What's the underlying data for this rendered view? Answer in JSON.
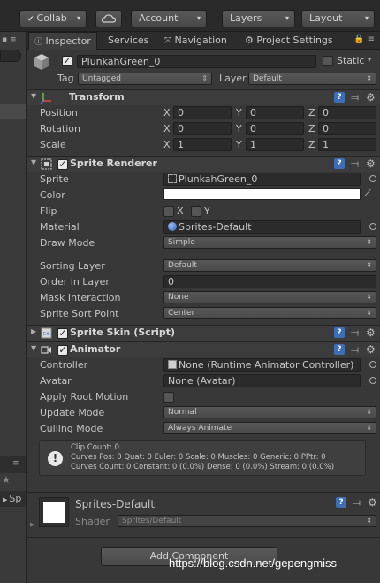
{
  "toolbar": {
    "collab_label": "Collab",
    "account_label": "Account",
    "layers_label": "Layers",
    "layout_label": "Layout",
    "cloud_icon": "cloud-icon",
    "close_glyph": "x"
  },
  "tabs": {
    "inspector": "Inspector",
    "services": "Services",
    "navigation": "Navigation",
    "project_settings": "Project Settings"
  },
  "left_panel": {
    "row_label": "Sp"
  },
  "object": {
    "name": "PlunkahGreen_0",
    "static_label": "Static",
    "tag_label": "Tag",
    "tag_value": "Untagged",
    "layer_label": "Layer",
    "layer_value": "Default"
  },
  "transform": {
    "title": "Transform",
    "position_label": "Position",
    "rotation_label": "Rotation",
    "scale_label": "Scale",
    "x_label": "X",
    "y_label": "Y",
    "z_label": "Z",
    "position": {
      "x": "0",
      "y": "0",
      "z": "0"
    },
    "rotation": {
      "x": "0",
      "y": "0",
      "z": "0"
    },
    "scale": {
      "x": "1",
      "y": "1",
      "z": "1"
    }
  },
  "sprite_renderer": {
    "title": "Sprite Renderer",
    "sprite_label": "Sprite",
    "sprite_value": "PlunkahGreen_0",
    "color_label": "Color",
    "color_value": "#ffffff",
    "flip_label": "Flip",
    "flip_x": "X",
    "flip_y": "Y",
    "material_label": "Material",
    "material_value": "Sprites-Default",
    "draw_mode_label": "Draw Mode",
    "draw_mode_value": "Simple",
    "sorting_layer_label": "Sorting Layer",
    "sorting_layer_value": "Default",
    "order_label": "Order in Layer",
    "order_value": "0",
    "mask_label": "Mask Interaction",
    "mask_value": "None",
    "sort_point_label": "Sprite Sort Point",
    "sort_point_value": "Center"
  },
  "sprite_skin": {
    "title": "Sprite Skin (Script)"
  },
  "animator": {
    "title": "Animator",
    "controller_label": "Controller",
    "controller_value": "None (Runtime Animator Controller)",
    "avatar_label": "Avatar",
    "avatar_value": "None (Avatar)",
    "root_motion_label": "Apply Root Motion",
    "update_mode_label": "Update Mode",
    "update_mode_value": "Normal",
    "culling_label": "Culling Mode",
    "culling_value": "Always Animate",
    "info_line1": "Clip Count: 0",
    "info_line2": "Curves Pos: 0 Quat: 0 Euler: 0 Scale: 0 Muscles: 0 Generic: 0 PPtr: 0",
    "info_line3": "Curves Count: 0 Constant: 0 (0.0%) Dense: 0 (0.0%) Stream: 0 (0.0%)"
  },
  "material": {
    "name": "Sprites-Default",
    "shader_label": "Shader",
    "shader_value": "Sprites/Default"
  },
  "add_component_label": "Add Component",
  "watermark": "https://blog.csdn.net/gepengmiss"
}
